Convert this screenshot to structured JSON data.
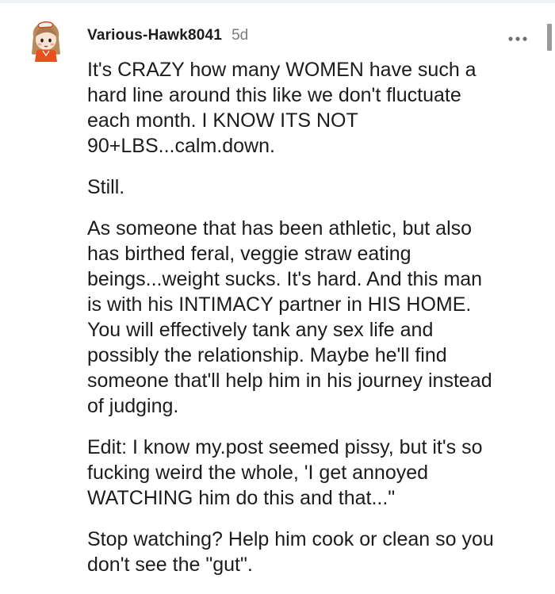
{
  "comment": {
    "author": "Various-Hawk8041",
    "timestamp": "5d",
    "more_icon": "more-horizontal-icon",
    "avatar_icon": "snoo-avatar-icon",
    "paragraphs": [
      "It's CRAZY how many WOMEN have such a\nhard line around this like we don't fluctuate\neach month. I KNOW ITS NOT\n90+LBS...calm.down.",
      "Still.",
      "As someone that has been athletic, but also\nhas birthed feral, veggie straw eating\nbeings...weight sucks. It's hard. And this man\nis with his INTIMACY partner in HIS HOME.\nYou will effectively tank any sex life and\npossibly the relationship. Maybe he'll find\nsomeone that'll help him in his journey instead\nof judging.",
      "Edit: I know my.post seemed pissy, but it's so\nfucking weird the whole, 'I get annoyed\nWATCHING him do this and that...\"",
      "Stop watching? Help him cook or clean so you\ndon't see the \"gut\"."
    ]
  }
}
